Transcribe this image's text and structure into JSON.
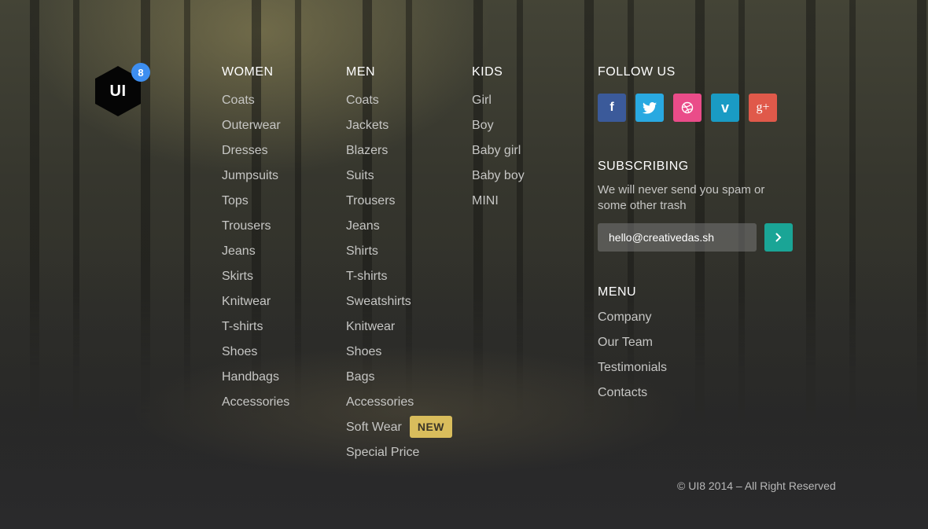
{
  "logo": {
    "text": "UI",
    "badge": "8"
  },
  "columns": {
    "women": {
      "title": "WOMEN",
      "items": [
        "Coats",
        "Outerwear",
        "Dresses",
        "Jumpsuits",
        "Tops",
        "Trousers",
        "Jeans",
        "Skirts",
        "Knitwear",
        "T-shirts",
        "Shoes",
        "Handbags",
        "Accessories"
      ]
    },
    "men": {
      "title": "MEN",
      "items": [
        "Coats",
        "Jackets",
        "Blazers",
        "Suits",
        "Trousers",
        "Jeans",
        "Shirts",
        "T-shirts",
        "Sweatshirts",
        "Knitwear",
        "Shoes",
        "Bags",
        "Accessories",
        "Soft Wear",
        "Special Price"
      ],
      "new_badge": "NEW"
    },
    "kids": {
      "title": "KIDS",
      "items": [
        "Girl",
        "Boy",
        "Baby girl",
        "Baby boy",
        "MINI"
      ]
    }
  },
  "follow": {
    "title": "FOLLOW US",
    "networks": [
      {
        "name": "facebook-icon",
        "glyph": "f",
        "color": "#3b5a9a"
      },
      {
        "name": "twitter-icon",
        "glyph": "t",
        "color": "#29a9e1"
      },
      {
        "name": "dribbble-icon",
        "glyph": "d",
        "color": "#ea4c89"
      },
      {
        "name": "vimeo-icon",
        "glyph": "v",
        "color": "#1a9bc4"
      },
      {
        "name": "google-plus-icon",
        "glyph": "g+",
        "color": "#e0594a"
      }
    ]
  },
  "subscribe": {
    "title": "SUBSCRIBING",
    "description": "We will never send you spam or some other trash",
    "email_value": "hello@creativedas.sh",
    "submit_glyph": "›"
  },
  "menu": {
    "title": "MENU",
    "items": [
      "Company",
      "Our Team",
      "Testimonials",
      "Contacts"
    ]
  },
  "copyright": "© UI8 2014 – All Right Reserved",
  "colors": {
    "accent_teal": "#1aa596",
    "badge_blue": "#3d8ef0",
    "new_badge": "#d9bd5c"
  }
}
